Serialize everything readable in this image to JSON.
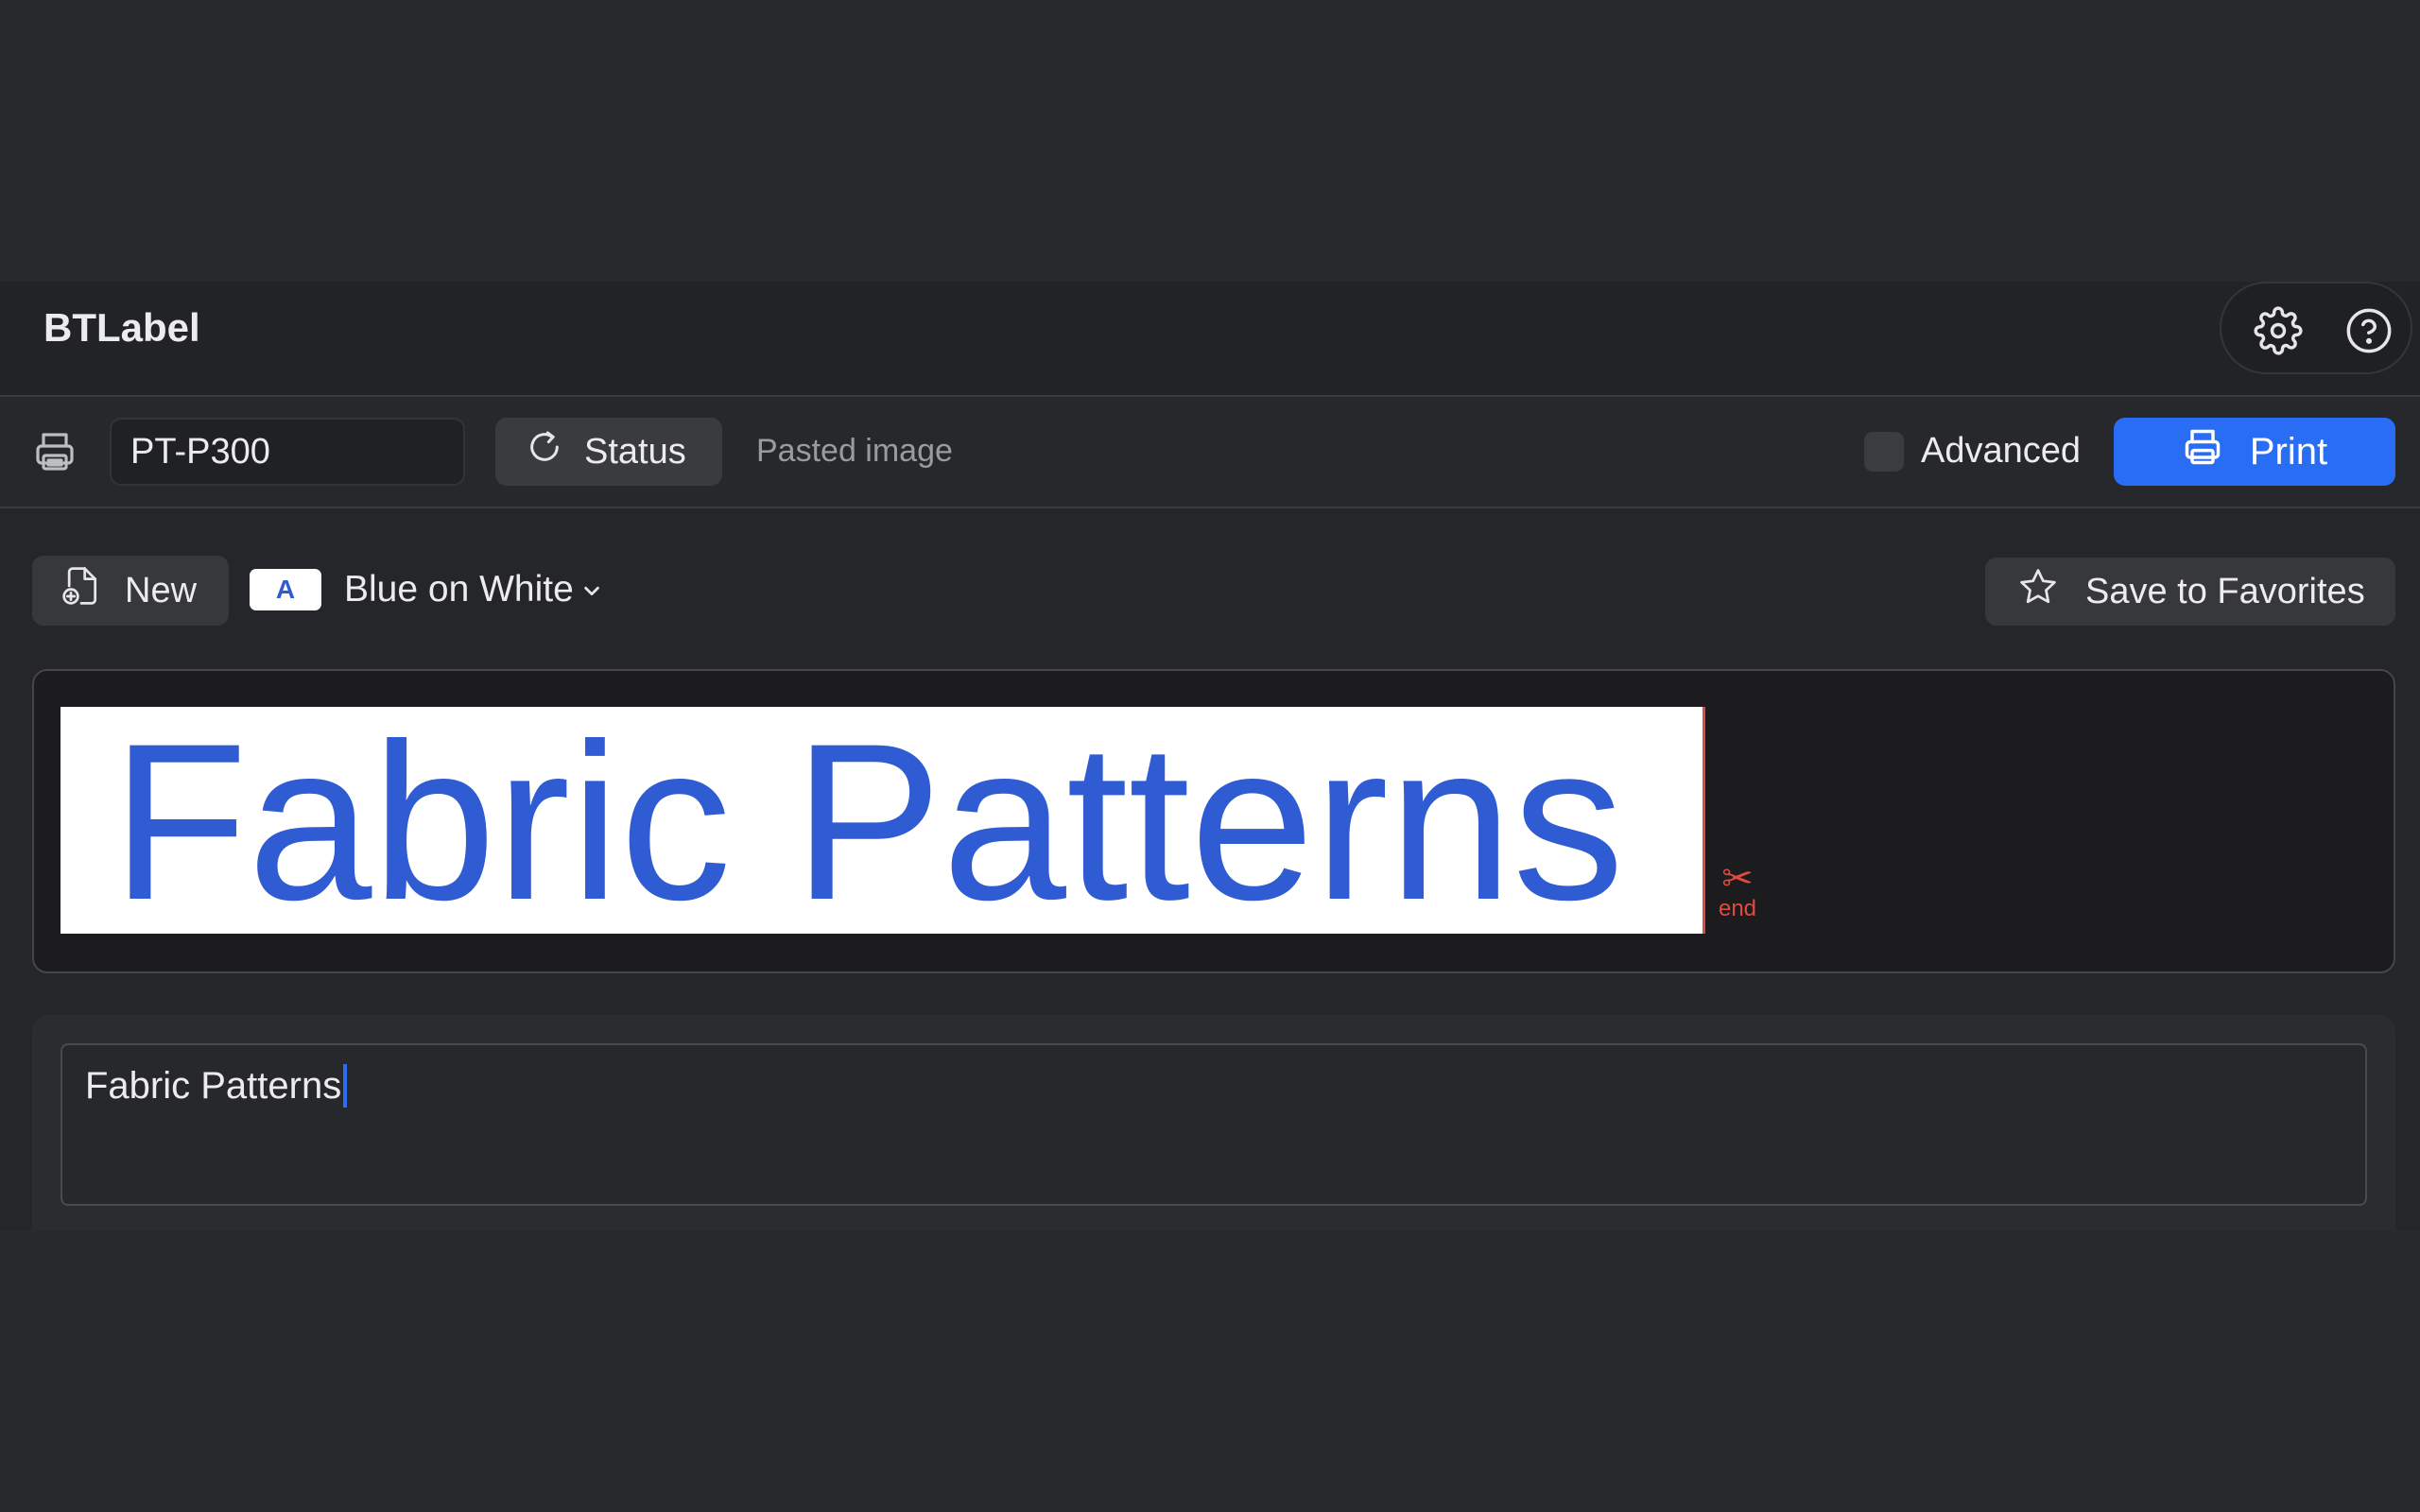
{
  "app": {
    "title": "BTLabel"
  },
  "titlebar": {
    "settings_icon": "gear-icon",
    "help_icon": "question-circle-icon"
  },
  "toolbar": {
    "printer_icon": "printer-icon",
    "printer_name": "PT-P300",
    "status_label": "Status",
    "status_icon": "refresh-icon",
    "status_message": "Pasted image",
    "advanced_label": "Advanced",
    "advanced_checked": false,
    "print_label": "Print",
    "print_icon": "printer-icon"
  },
  "actions": {
    "new_label": "New",
    "new_icon": "new-document-icon",
    "color_chip_letter": "A",
    "color_scheme": "Blue on White",
    "save_favorites_label": "Save to Favorites",
    "save_favorites_icon": "star-icon"
  },
  "preview": {
    "label_text": "Fabric Patterns",
    "end_marker": "end",
    "text_color": "#2f5bd3",
    "background_color": "#ffffff",
    "cut_line_color": "#e04a3f"
  },
  "editor": {
    "value": "Fabric Patterns"
  },
  "colors": {
    "accent": "#2a6df5",
    "window_bg": "#25262a"
  }
}
